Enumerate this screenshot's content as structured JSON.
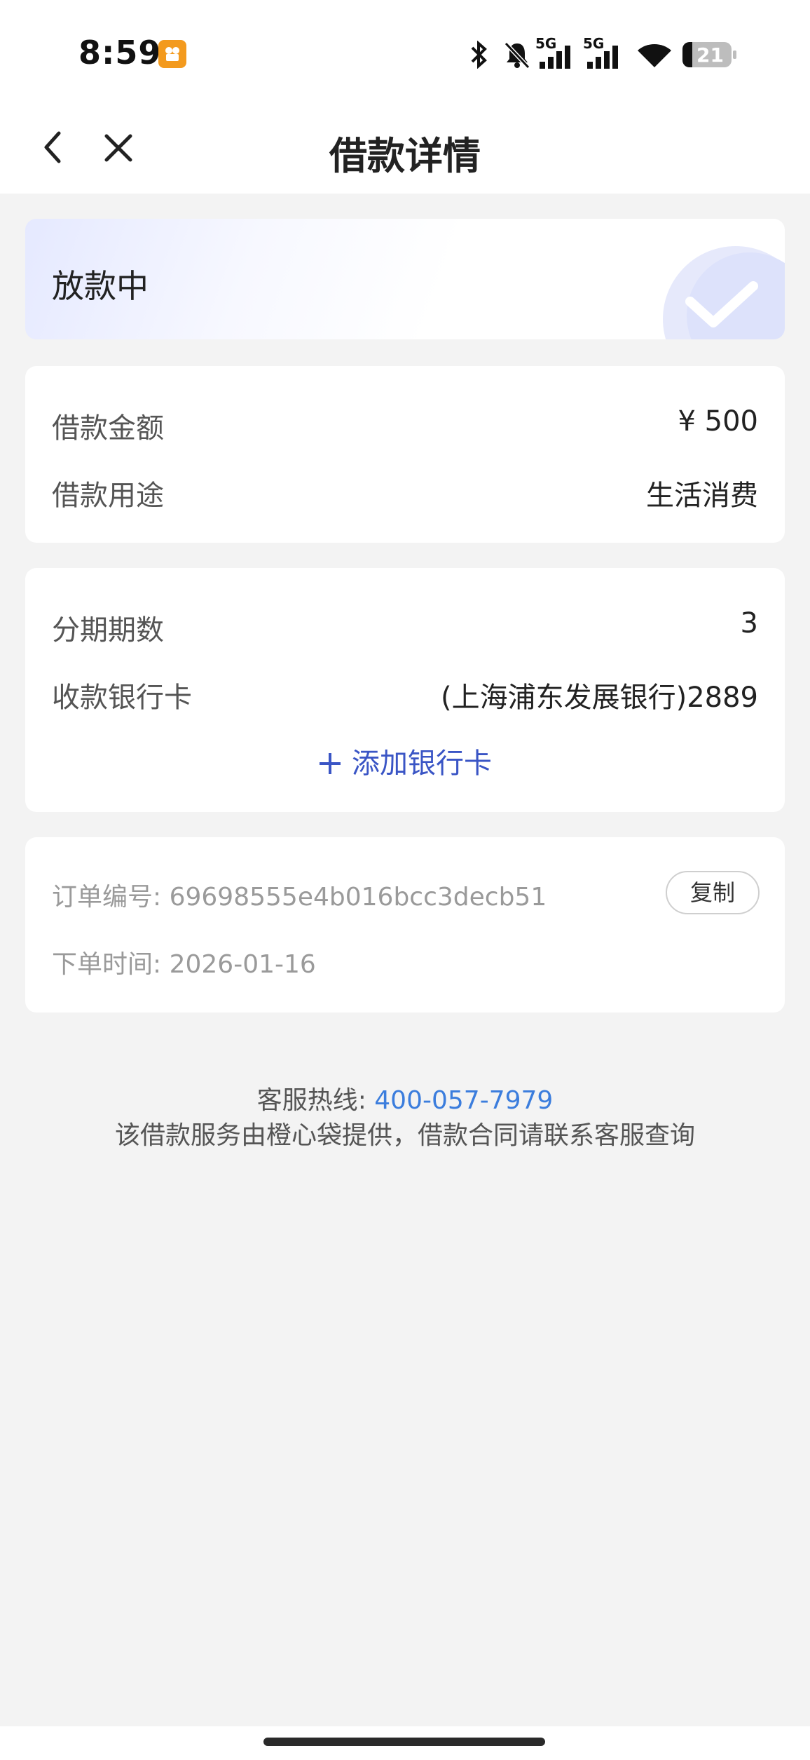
{
  "status_bar": {
    "time": "8:59",
    "network_1": "5G",
    "network_2": "5G",
    "battery_level": "21",
    "icons": [
      "bluetooth-icon",
      "bell-muted-icon",
      "signal-icon",
      "signal-icon",
      "wifi-icon",
      "battery-icon"
    ]
  },
  "nav": {
    "title": "借款详情",
    "back_icon": "chevron-left-icon",
    "close_icon": "close-icon"
  },
  "status_card": {
    "status": "放款中",
    "icon": "check-circle-icon"
  },
  "loan_info": {
    "amount_label": "借款金额",
    "amount_value": "¥ 500",
    "purpose_label": "借款用途",
    "purpose_value": "生活消费"
  },
  "repayment": {
    "installments_label": "分期期数",
    "installments_value": "3",
    "card_label": "收款银行卡",
    "card_value": "(上海浦东发展银行)2889",
    "add_card_label": "添加银行卡"
  },
  "order": {
    "number_label": "订单编号:",
    "number_value": "69698555e4b016bcc3decb51",
    "copy_label": "复制",
    "time_label": "下单时间:",
    "time_value": "2026-01-16"
  },
  "footer": {
    "hotline_label": "客服热线:",
    "hotline_number": "400-057-7979",
    "notice": "该借款服务由橙心袋提供，借款合同请联系客服查询"
  },
  "colors": {
    "accent": "#3a55c5",
    "link": "#3b7ddd",
    "background": "#f3f3f3"
  }
}
